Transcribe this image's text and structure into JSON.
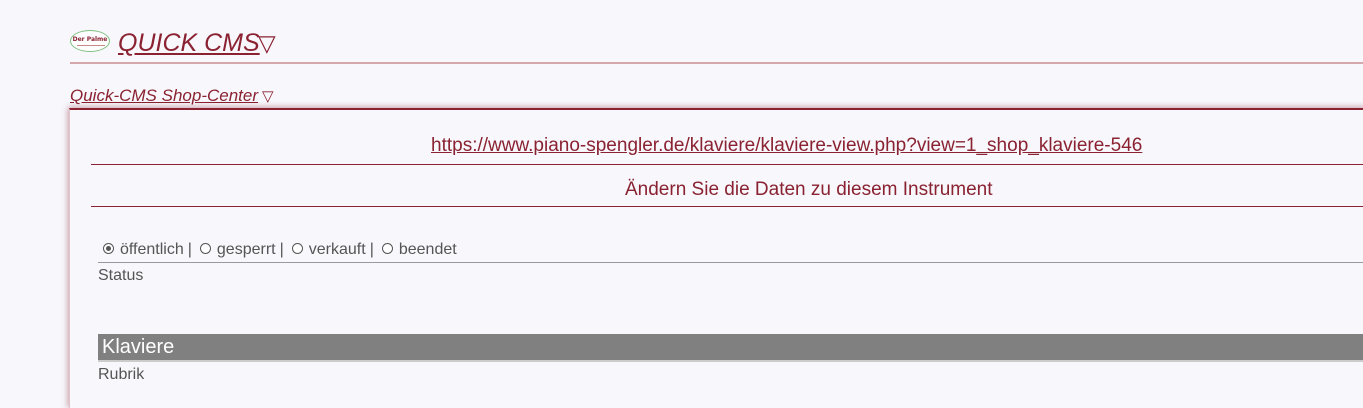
{
  "header": {
    "logo_text": "Der Palme",
    "title": "QUICK CMS",
    "title_caret": "▽"
  },
  "subnav": {
    "label": "Quick-CMS Shop-Center",
    "caret": "▽"
  },
  "panel": {
    "url": "https://www.piano-spengler.de/klaviere/klaviere-view.php?view=1_shop_klaviere-546",
    "heading": "Ändern Sie die Daten zu diesem Instrument",
    "status": {
      "options": [
        {
          "label": "öffentlich",
          "selected": true
        },
        {
          "label": "gesperrt",
          "selected": false
        },
        {
          "label": "verkauft",
          "selected": false
        },
        {
          "label": "beendet",
          "selected": false
        }
      ],
      "separator": "|",
      "label": "Status"
    },
    "rubrik": {
      "value": "Klaviere",
      "label": "Rubrik"
    }
  },
  "colors": {
    "accent": "#8a2231",
    "background": "#f7f7fc",
    "bar": "#808080"
  }
}
